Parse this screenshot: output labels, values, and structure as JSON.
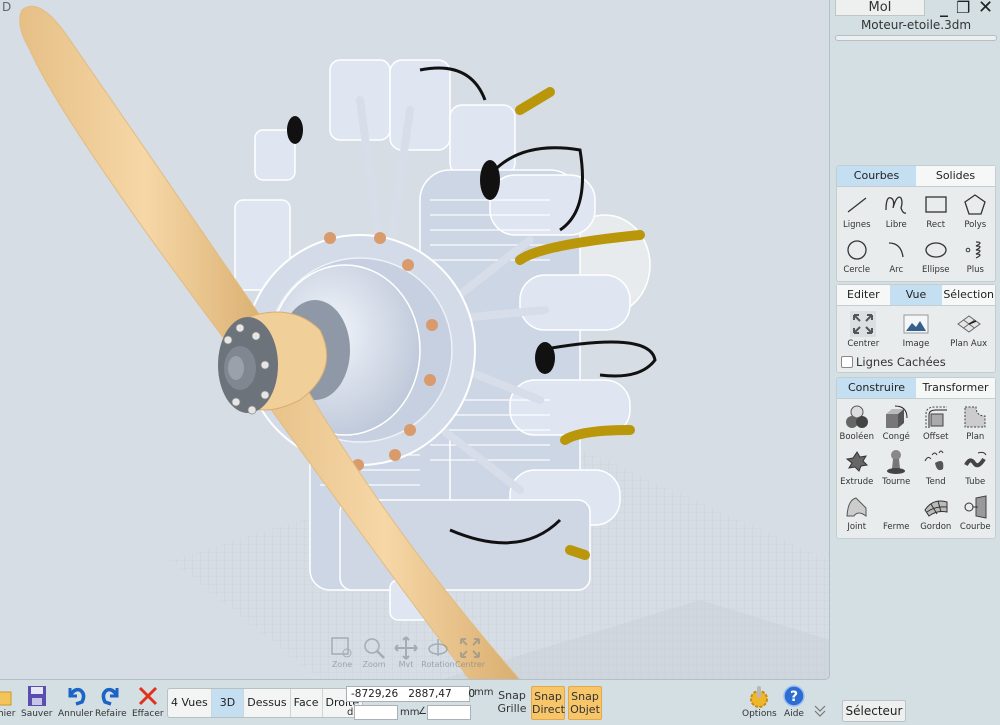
{
  "viewport": {
    "view_label": "D",
    "nav_overlay": [
      {
        "icon": "zone-zoom-icon",
        "label": "Zone"
      },
      {
        "icon": "zoom-icon",
        "label": "Zoom"
      },
      {
        "icon": "pan-icon",
        "label": "Mvt"
      },
      {
        "icon": "rotate-icon",
        "label": "Rotation"
      },
      {
        "icon": "center-icon",
        "label": "Centrer"
      }
    ]
  },
  "window": {
    "title_button": "MoI",
    "filename": "Moteur-etoile.3dm",
    "progress": 0.0,
    "controls": {
      "minimize": "_",
      "restore": "❐",
      "close": "✕"
    }
  },
  "curves_panel": {
    "tabs": [
      {
        "label": "Courbes",
        "active": true
      },
      {
        "label": "Solides",
        "active": false
      }
    ],
    "tools": [
      {
        "icon": "line-icon",
        "label": "Lignes"
      },
      {
        "icon": "freeform-curve-icon",
        "label": "Libre"
      },
      {
        "icon": "rectangle-icon",
        "label": "Rect"
      },
      {
        "icon": "polygon-icon",
        "label": "Polys"
      },
      {
        "icon": "circle-icon",
        "label": "Cercle"
      },
      {
        "icon": "arc-icon",
        "label": "Arc"
      },
      {
        "icon": "ellipse-icon",
        "label": "Ellipse"
      },
      {
        "icon": "helix-icon",
        "label": "Plus"
      }
    ]
  },
  "view_panel": {
    "tabs": [
      {
        "label": "Editer",
        "active": false
      },
      {
        "label": "Vue",
        "active": true
      },
      {
        "label": "Sélection",
        "active": false
      }
    ],
    "tools": [
      {
        "icon": "center-icon",
        "label": "Centrer"
      },
      {
        "icon": "image-icon",
        "label": "Image"
      },
      {
        "icon": "construction-plane-icon",
        "label": "Plan Aux"
      }
    ],
    "hidden_lines": {
      "label": "Lignes Cachées",
      "checked": false
    }
  },
  "construct_panel": {
    "tabs": [
      {
        "label": "Construire",
        "active": true
      },
      {
        "label": "Transformer",
        "active": false
      }
    ],
    "tools": [
      {
        "icon": "boolean-icon",
        "label": "Booléen"
      },
      {
        "icon": "fillet-icon",
        "label": "Congé"
      },
      {
        "icon": "offset-icon",
        "label": "Offset"
      },
      {
        "icon": "planar-icon",
        "label": "Plan"
      },
      {
        "icon": "extrude-icon",
        "label": "Extrude"
      },
      {
        "icon": "revolve-icon",
        "label": "Tourne"
      },
      {
        "icon": "loft-icon",
        "label": "Tend"
      },
      {
        "icon": "pipe-icon",
        "label": "Tube"
      },
      {
        "icon": "blend-icon",
        "label": "Joint"
      },
      {
        "icon": "shell-icon",
        "label": "Ferme"
      },
      {
        "icon": "network-icon",
        "label": "Gordon"
      },
      {
        "icon": "project-curve-icon",
        "label": "Courbe"
      }
    ]
  },
  "bottom_bar": {
    "file_tools": [
      {
        "icon": "folder-icon",
        "label": "Fichier"
      },
      {
        "icon": "save-icon",
        "label": "Sauver"
      },
      {
        "icon": "undo-icon",
        "label": "Annuler"
      },
      {
        "icon": "redo-icon",
        "label": "Refaire"
      },
      {
        "icon": "delete-icon",
        "label": "Effacer"
      }
    ],
    "views": [
      {
        "label": "4 Vues",
        "active": false
      },
      {
        "label": "3D",
        "active": true
      },
      {
        "label": "Dessus",
        "active": false
      },
      {
        "label": "Face",
        "active": false
      },
      {
        "label": "Droite",
        "active": false
      }
    ],
    "coords": {
      "x": "-8729,26",
      "y": "2887,47",
      "z": "0",
      "unit": "mm"
    },
    "distance": {
      "prefix": "d",
      "value": "",
      "unit": "mm",
      "angle_symbol": "∠",
      "angle_value": ""
    },
    "snaps": [
      {
        "label": "Snap Grille",
        "on": false
      },
      {
        "label": "Snap Direct",
        "on": true
      },
      {
        "label": "Snap Objet",
        "on": true
      }
    ],
    "options_label": "Options",
    "help_label": "Aide",
    "expand_icon": "double-chevron-down-icon",
    "selector_label": "Sélecteur"
  },
  "colors": {
    "background": "#d3dfe3",
    "viewport": "#d6dde4",
    "active_tab": "#c4dff2",
    "snap_on": "#f7c56a",
    "propeller": "#f0cf98",
    "engine": "#dfe6f2"
  }
}
